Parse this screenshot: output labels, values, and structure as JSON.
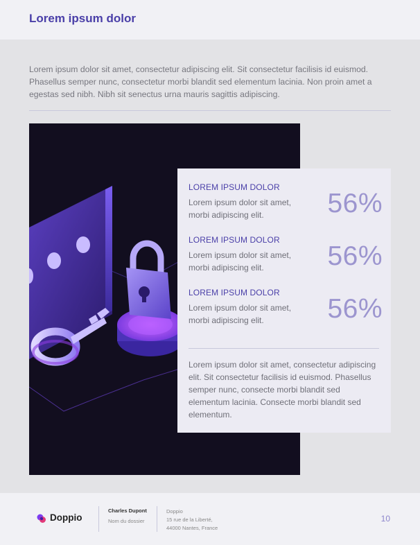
{
  "header": {
    "title": "Lorem ipsum dolor"
  },
  "intro": "Lorem ipsum dolor sit amet, consectetur adipiscing elit. Sit consectetur facilisis id euismod. Phasellus semper nunc, consectetur morbi blandit sed elementum lacinia. Non proin amet a egestas sed nibh. Nibh sit senectus urna mauris sagittis adipiscing.",
  "stats": [
    {
      "label": "LOREM IPSUM DOLOR",
      "desc": "Lorem ipsum dolor sit amet, morbi adipiscing elit.",
      "value": "56%"
    },
    {
      "label": "LOREM IPSUM DOLOR",
      "desc": "Lorem ipsum dolor sit amet, morbi adipiscing elit.",
      "value": "56%"
    },
    {
      "label": "LOREM IPSUM DOLOR",
      "desc": "Lorem ipsum dolor sit amet, morbi adipiscing elit.",
      "value": "56%"
    }
  ],
  "card_text": "Lorem ipsum dolor sit amet, consectetur adipiscing elit. Sit consectetur facilisis id euismod. Phasellus semper nunc, consecte morbi blandit sed elementum lacinia. Consecte morbi blandit sed elementum.",
  "illustration": {
    "icon": "security-lock-key-illustration"
  },
  "footer": {
    "logo_text": "Doppio",
    "author_name": "Charles Dupont",
    "author_file": "Nom du dossier",
    "company_name": "Doppio",
    "company_address_1": "15 rue de la Liberté,",
    "company_address_2": "44000 Nantes, France",
    "page_number": "10"
  },
  "colors": {
    "accent": "#4a3fa8",
    "stat_value": "#9c95cf",
    "illustration_bg": "#120e1f"
  }
}
